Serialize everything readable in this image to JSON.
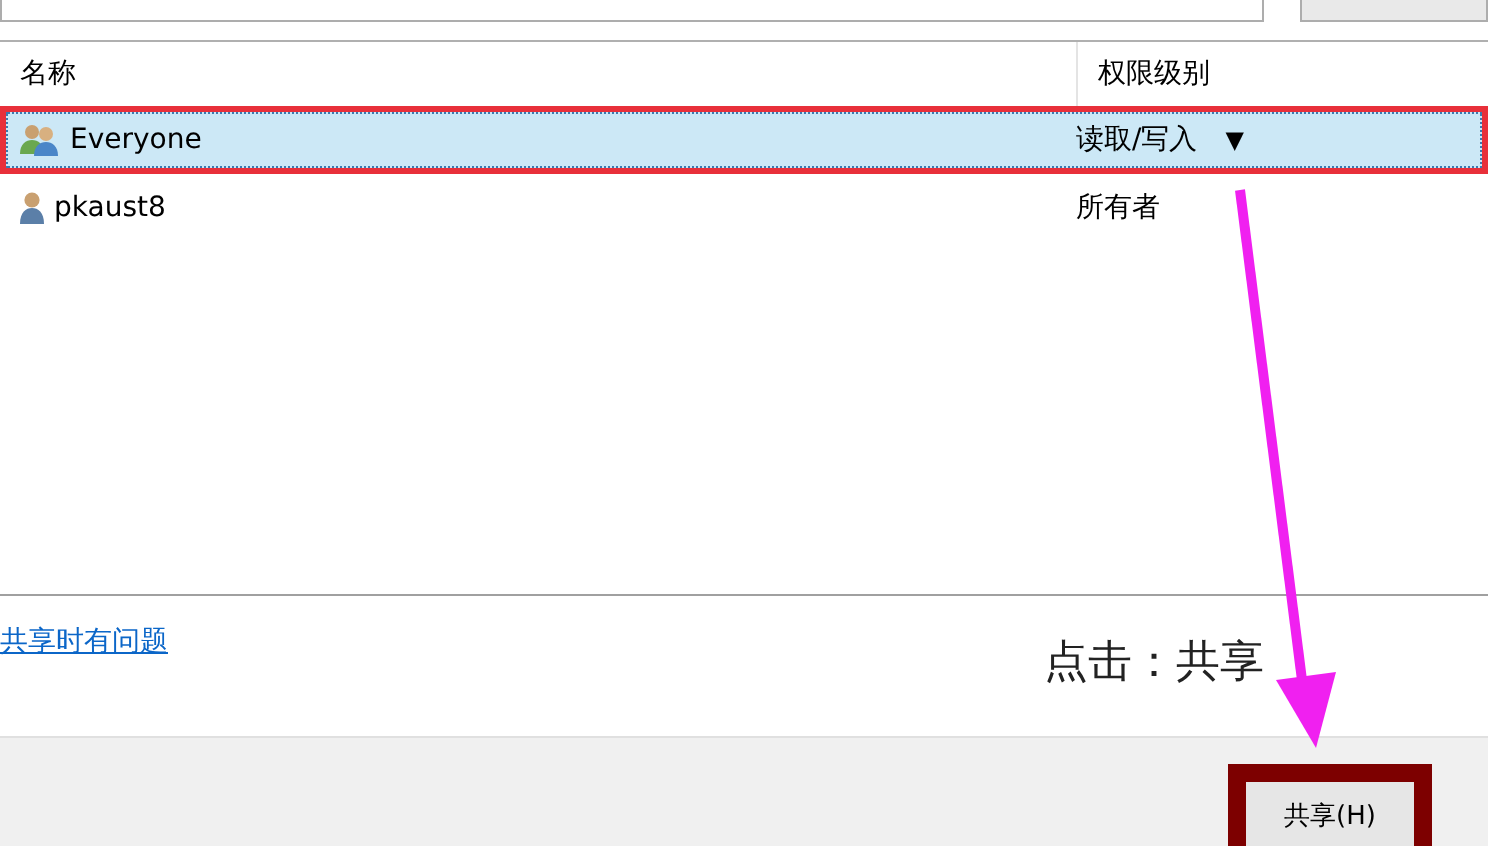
{
  "columns": [
    {
      "label": "名称"
    },
    {
      "label": "权限级别"
    }
  ],
  "rows": [
    {
      "name": "Everyone",
      "kind": "group",
      "permission": "读取/写入",
      "dropdown": "▼",
      "selected": true,
      "highlighted": true
    },
    {
      "name": "pkaust8",
      "kind": "user",
      "permission": "所有者",
      "selected": false,
      "highlighted": false
    }
  ],
  "help_link": "共享时有问题",
  "annotation": {
    "text": "点击：共享"
  },
  "share_button": {
    "label": "共享(H)",
    "highlighted": true
  }
}
